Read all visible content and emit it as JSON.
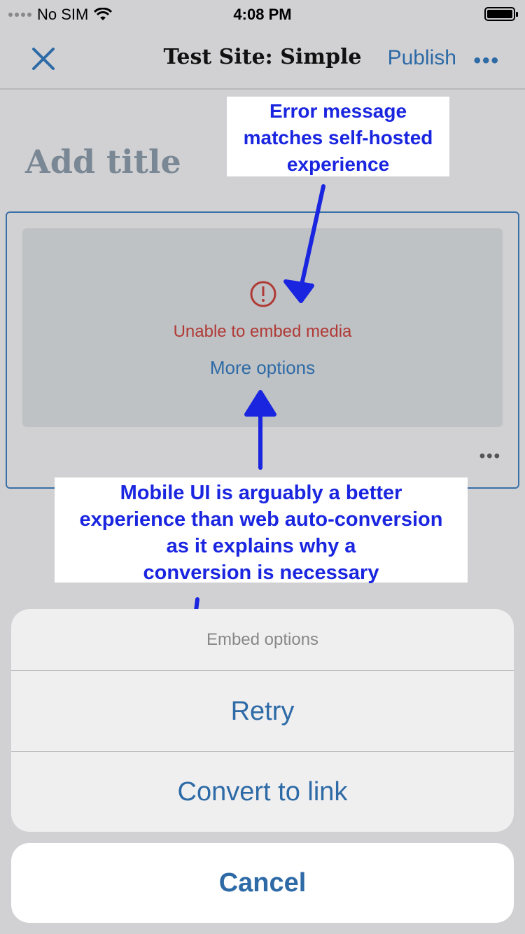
{
  "status_bar": {
    "carrier": "No SIM",
    "time": "4:08 PM"
  },
  "nav": {
    "title": "Test Site: Simple",
    "publish_label": "Publish",
    "more_label": "•••"
  },
  "editor": {
    "title_placeholder": "Add title",
    "embed": {
      "error_text": "Unable to embed media",
      "more_options_label": "More options",
      "block_menu_label": "•••"
    }
  },
  "annotations": {
    "top_lines": [
      "Error message",
      "matches self-hosted",
      "experience"
    ],
    "middle_lines": [
      "Mobile UI is arguably a better",
      "experience than web auto-conversion",
      "as it explains why a",
      "conversion is necessary"
    ],
    "color": "#1a25e0"
  },
  "action_sheet": {
    "title": "Embed options",
    "options": [
      "Retry",
      "Convert to link"
    ],
    "cancel_label": "Cancel"
  },
  "colors": {
    "accent": "#2d6aa6",
    "error": "#b03a36",
    "dim_background": "#d1d1d3"
  }
}
